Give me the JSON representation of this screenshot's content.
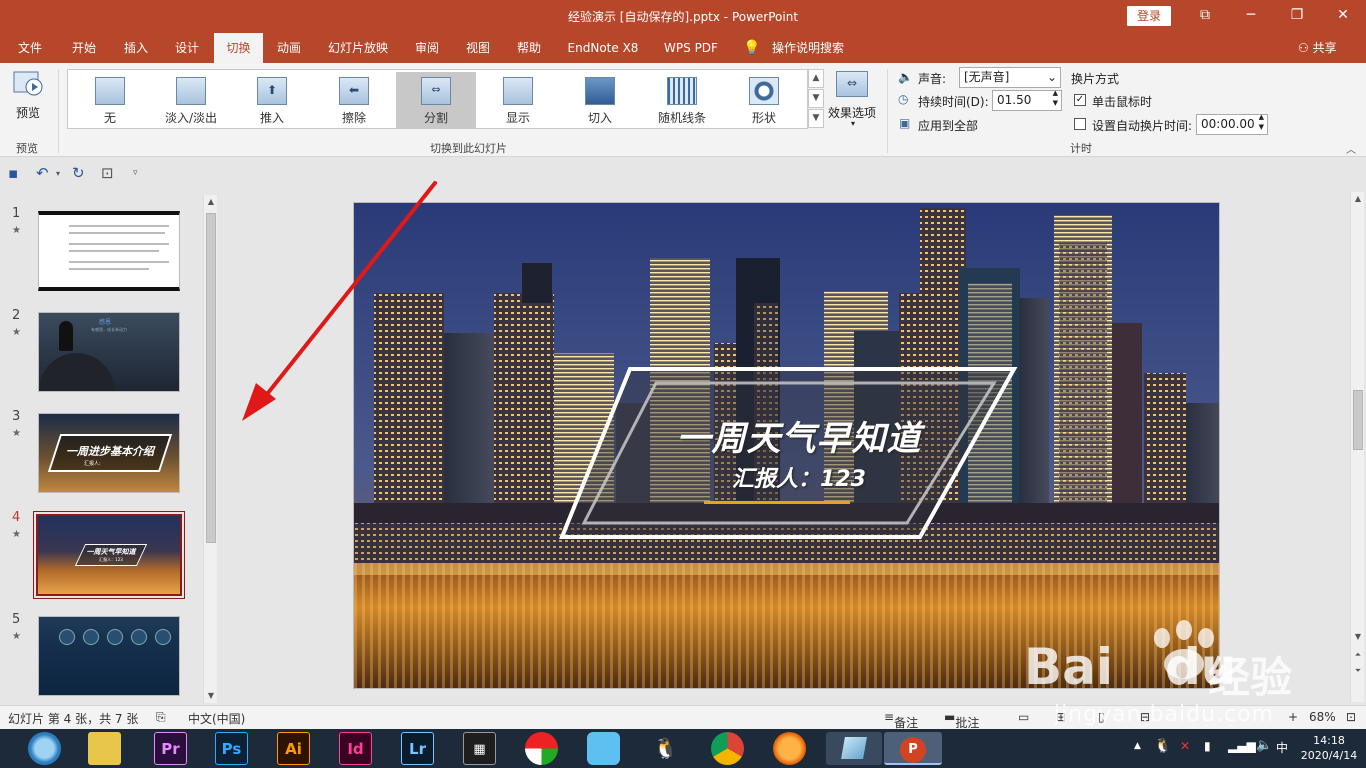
{
  "window": {
    "title": "经验演示 [自动保存的].pptx - PowerPoint",
    "login_label": "登录",
    "controls": [
      "⧉",
      "─",
      "❐",
      "✕"
    ]
  },
  "menu": {
    "tabs": [
      "文件",
      "开始",
      "插入",
      "设计",
      "切换",
      "动画",
      "幻灯片放映",
      "审阅",
      "视图",
      "帮助",
      "EndNote X8",
      "WPS PDF"
    ],
    "active_tab": "切换",
    "search_label": "操作说明搜索",
    "share_label": "共享"
  },
  "ribbon": {
    "preview": {
      "button_label": "预览",
      "group_label": "预览"
    },
    "transitions": {
      "items": [
        "无",
        "淡入/淡出",
        "推入",
        "擦除",
        "分割",
        "显示",
        "切入",
        "随机线条",
        "形状"
      ],
      "selected": "分割",
      "effects_label": "效果选项",
      "group_label": "切换到此幻灯片"
    },
    "timing": {
      "sound_label": "声音:",
      "sound_value": "[无声音]",
      "duration_label": "持续时间(D):",
      "duration_value": "01.50",
      "apply_all_label": "应用到全部",
      "advance_label": "换片方式",
      "on_click_label": "单击鼠标时",
      "on_click_checked": true,
      "auto_label": "设置自动换片时间:",
      "auto_value": "00:00.00",
      "auto_checked": false,
      "group_label": "计时"
    }
  },
  "thumbnails": [
    {
      "num": "1",
      "star": "★"
    },
    {
      "num": "2",
      "star": "★",
      "title": "感恩",
      "subtitle": "有感恩，成长有动力"
    },
    {
      "num": "3",
      "star": "★",
      "title": "一周进步基本介绍",
      "subtitle": "汇报人:"
    },
    {
      "num": "4",
      "star": "★",
      "title": "一周天气早知道",
      "subtitle": "汇报人：123",
      "active": true
    },
    {
      "num": "5",
      "star": "★"
    }
  ],
  "slide": {
    "title": "一周天气早知道",
    "subtitle": "汇报人：123"
  },
  "status": {
    "slide_info": "幻灯片 第 4 张，共 7 张",
    "language": "中文(中国)",
    "notes_label": "备注",
    "comments_label": "批注",
    "zoom": "68%"
  },
  "taskbar": {
    "apps": [
      "Pr",
      "Ps",
      "Ai",
      "Id",
      "Lr"
    ],
    "time": "14:18",
    "date": "2020/4/14"
  },
  "watermark": {
    "brand": "Bai",
    "brand2": "du",
    "cn": "经验",
    "url": "jingyan.baidu.com"
  },
  "colors": {
    "accent": "#b7472a",
    "active_thumb_border": "#8b1a1a",
    "slide_gold_line": "#e7a21e"
  }
}
